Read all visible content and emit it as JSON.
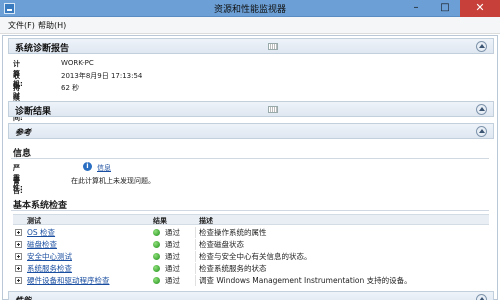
{
  "window": {
    "title": "资源和性能监视器"
  },
  "menu": {
    "file": "文件(F)",
    "help": "帮助(H)"
  },
  "report": {
    "title": "系统诊断报告",
    "fields": [
      {
        "label": "计算机:",
        "value": "WORK-PC"
      },
      {
        "label": "收集时间:",
        "value": "2013年8月9日 17:13:54"
      },
      {
        "label": "持续时间:",
        "value": "62 秒"
      }
    ]
  },
  "diagnostics": {
    "title": "诊断结果"
  },
  "reference": {
    "title": "参考"
  },
  "info": {
    "title": "信息",
    "severity_label": "严重性:",
    "severity_value": "信息",
    "warning_label": "警告:",
    "warning_value": "在此计算机上未发现问题。"
  },
  "checks": {
    "title": "基本系统检查",
    "columns": {
      "test": "测试",
      "result": "结果",
      "desc": "描述"
    },
    "rows": [
      {
        "test": "OS 检查",
        "result": "通过",
        "desc": "检查操作系统的属性"
      },
      {
        "test": "磁盘检查",
        "result": "通过",
        "desc": "检查磁盘状态"
      },
      {
        "test": "安全中心测试",
        "result": "通过",
        "desc": "检查与安全中心有关信息的状态。"
      },
      {
        "test": "系统服务检查",
        "result": "通过",
        "desc": "检查系统服务的状态"
      },
      {
        "test": "硬件设备和驱动程序检查",
        "result": "通过",
        "desc": "调查 Windows Management Instrumentation 支持的设备。"
      }
    ]
  },
  "partial_section": {
    "title": "性能"
  },
  "colors": {
    "pass": "#1f8f1a",
    "link": "#1a4ea0",
    "titlebar": "#6b9fd6"
  }
}
